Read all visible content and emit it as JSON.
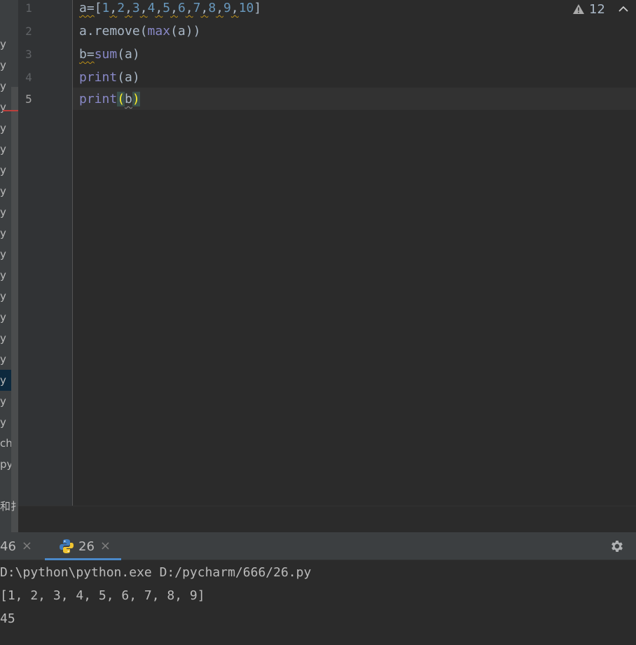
{
  "project_tree": {
    "items": [
      {
        "label": "y",
        "selected": false
      },
      {
        "label": "y",
        "selected": false
      },
      {
        "label": "y",
        "selected": false
      },
      {
        "label": "y",
        "selected": false
      },
      {
        "label": "y",
        "selected": false
      },
      {
        "label": "y",
        "selected": false
      },
      {
        "label": "y",
        "selected": false
      },
      {
        "label": "y",
        "selected": false
      },
      {
        "label": "y",
        "selected": false
      },
      {
        "label": "y",
        "selected": false
      },
      {
        "label": "y",
        "selected": false
      },
      {
        "label": "y",
        "selected": false
      },
      {
        "label": "y",
        "selected": false
      },
      {
        "label": "y",
        "selected": false
      },
      {
        "label": "y",
        "selected": false
      },
      {
        "label": "y",
        "selected": false
      },
      {
        "label": "y",
        "selected": true
      },
      {
        "label": "y",
        "selected": false
      },
      {
        "label": "y",
        "selected": false
      },
      {
        "label": "ch.p",
        "selected": false
      },
      {
        "label": "py",
        "selected": false
      }
    ],
    "stub_label": "和扌"
  },
  "editor": {
    "line_numbers": [
      "1",
      "2",
      "3",
      "4",
      "5"
    ],
    "lines": [
      "a=[1,2,3,4,5,6,7,8,9,10]",
      "a.remove(max(a))",
      "b=sum(a)",
      "print(a)",
      "print(b)"
    ],
    "current_line": "5",
    "inspection": {
      "warning_count": "12",
      "icon": "warning-icon",
      "nav_icon": "chevron-up-icon"
    }
  },
  "run_panel": {
    "tabs": [
      {
        "label": "46",
        "active": false,
        "close": "×"
      },
      {
        "label": "26",
        "active": true,
        "close": "×",
        "icon": "python-icon"
      }
    ],
    "settings_icon": "gear-icon",
    "console": [
      "D:\\python\\python.exe D:/pycharm/666/26.py",
      "[1, 2, 3, 4, 5, 6, 7, 8, 9]",
      "45"
    ]
  },
  "colors": {
    "editor_bg": "#2b2b2b",
    "gutter_bg": "#313335",
    "panel_bg": "#3c3f41",
    "keyword_builtin": "#8888c6",
    "number": "#6897bb",
    "text": "#a9b7c6",
    "warning_underline": "#be9117",
    "accent": "#4a88c7"
  }
}
